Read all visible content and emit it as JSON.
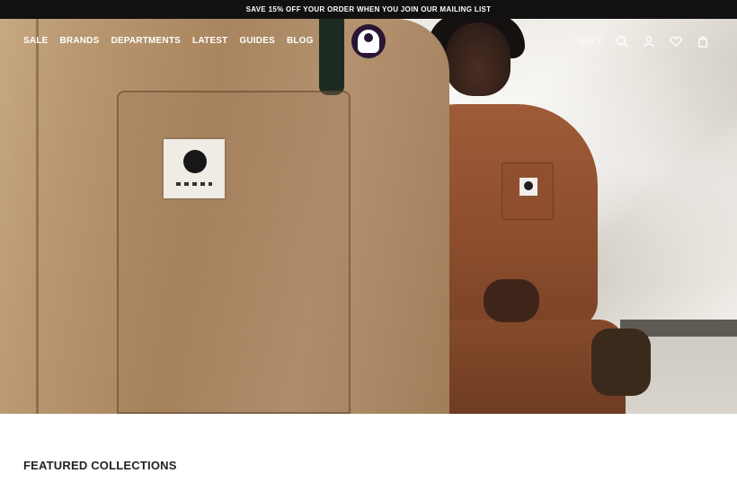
{
  "promo": {
    "text": "SAVE 15% OFF YOUR ORDER WHEN YOU JOIN OUR MAILING LIST"
  },
  "nav": {
    "items": [
      "SALE",
      "BRANDS",
      "DEPARTMENTS",
      "LATEST",
      "GUIDES",
      "BLOG"
    ]
  },
  "header": {
    "currency": "GBP £",
    "icons": [
      "search-icon",
      "account-icon",
      "wishlist-icon",
      "bag-icon"
    ]
  },
  "sections": {
    "featured_title": "FEATURED COLLECTIONS"
  },
  "colors": {
    "promo_bg": "#111111",
    "logo_bg": "#2a1535"
  }
}
